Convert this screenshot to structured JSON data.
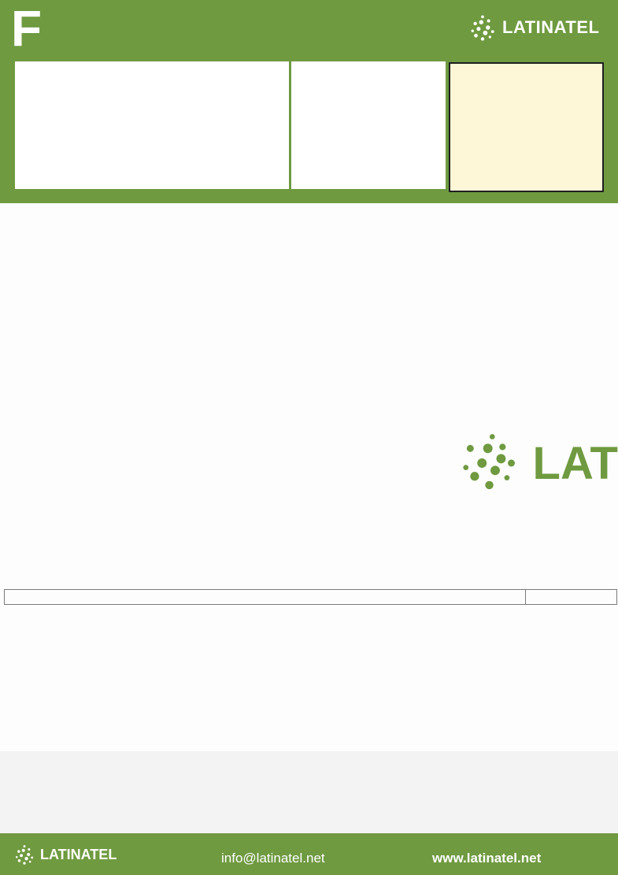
{
  "header": {
    "letter": "F",
    "brand_name": "LATINATEL"
  },
  "body": {
    "brand_name_partial": "LAT"
  },
  "footer": {
    "brand_name": "LATINATEL",
    "email": "info@latinatel.net",
    "website": "www.latinatel.net"
  },
  "colors": {
    "brand_green": "#6f9a40",
    "note_fill": "#fdf7d7",
    "footer_band": "#f3f3f3"
  },
  "icons": {
    "brand_logo": "dot-cluster-icon"
  }
}
